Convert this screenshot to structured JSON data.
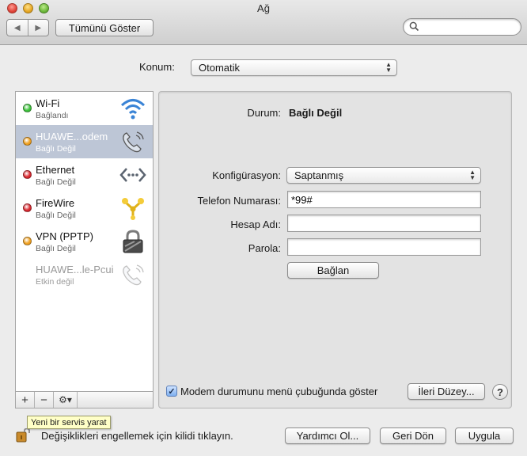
{
  "window": {
    "title": "Ağ"
  },
  "toolbar": {
    "show_all_label": "Tümünü Göster",
    "back_glyph": "◀",
    "forward_glyph": "▶",
    "search_placeholder": ""
  },
  "location": {
    "label": "Konum:",
    "value": "Otomatik"
  },
  "services": [
    {
      "name": "Wi-Fi",
      "status": "Bağlandı",
      "status_color": "#3cc23a",
      "icon": "wifi-icon",
      "selected": false,
      "active": true
    },
    {
      "name": "HUAWE...odem",
      "status": "Bağlı Değil",
      "status_color": "#f0a020",
      "icon": "modem-phone-icon",
      "selected": true,
      "active": true
    },
    {
      "name": "Ethernet",
      "status": "Bağlı Değil",
      "status_color": "#d9272e",
      "icon": "ethernet-icon",
      "selected": false,
      "active": true
    },
    {
      "name": "FireWire",
      "status": "Bağlı Değil",
      "status_color": "#d9272e",
      "icon": "firewire-icon",
      "selected": false,
      "active": true
    },
    {
      "name": "VPN (PPTP)",
      "status": "Bağlı Değil",
      "status_color": "#f0a020",
      "icon": "vpn-lock-icon",
      "selected": false,
      "active": true
    },
    {
      "name": "HUAWE...le-Pcui",
      "status": "Etkin değil",
      "status_color": "",
      "icon": "modem-phone-icon",
      "selected": false,
      "active": false
    }
  ],
  "list_bar": {
    "add": "+",
    "remove": "−",
    "gear": "⚙▾"
  },
  "detail": {
    "status_label": "Durum:",
    "status_value": "Bağlı Değil",
    "config_label": "Konfigürasyon:",
    "config_value": "Saptanmış",
    "phone_label": "Telefon Numarası:",
    "phone_value": "*99#",
    "account_label": "Hesap Adı:",
    "account_value": "",
    "password_label": "Parola:",
    "password_value": "",
    "connect_label": "Bağlan",
    "modem_checkbox_label": "Modem durumunu menü çubuğunda göster",
    "modem_checkbox_checked": true,
    "advanced_label": "İleri Düzey...",
    "help_label": "?"
  },
  "footer": {
    "tooltip": "Yeni bir servis yarat",
    "lock_text": "Değişiklikleri engellemek için kilidi tıklayın.",
    "assistant_label": "Yardımcı Ol...",
    "revert_label": "Geri Dön",
    "apply_label": "Uygula"
  },
  "colors": {
    "selection": "#bdc6d6",
    "accent_blue": "#3a84d6"
  }
}
